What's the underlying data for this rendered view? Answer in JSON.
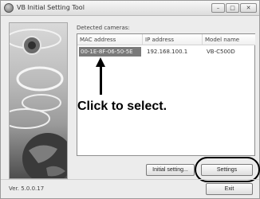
{
  "window": {
    "title": "VB Initial Setting Tool",
    "controls": {
      "minimize": "–",
      "maximize": "□",
      "close": "✕"
    }
  },
  "cameras": {
    "label": "Detected cameras:",
    "columns": [
      "MAC address",
      "IP address",
      "Model name"
    ],
    "rows": [
      {
        "mac": "00-1E-8F-06-50-5E",
        "ip": "192.168.100.1",
        "model": "VB-C500D",
        "selected": true
      }
    ]
  },
  "annotation": {
    "callout": "Click to select."
  },
  "buttons": {
    "initial_setting": "Initial setting...",
    "settings": "Settings",
    "exit": "Exit"
  },
  "footer": {
    "version": "Ver. 5.0.0.17"
  },
  "icons": {
    "app": "camera-app-icon",
    "minimize": "minimize-icon",
    "maximize": "maximize-icon",
    "close": "close-icon"
  },
  "colors": {
    "selection": "#7a7a7a",
    "callout": "#000000"
  }
}
